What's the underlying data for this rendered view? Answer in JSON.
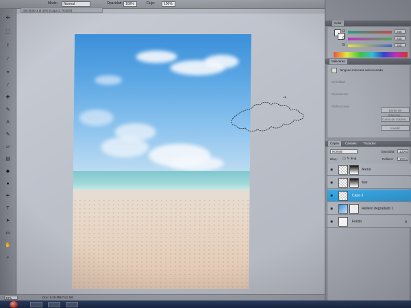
{
  "options_bar": {
    "mode_label": "Modo:",
    "mode_value": "Normal",
    "opacity_label": "Opacidad:",
    "opacity_value": "100%",
    "flow_label": "Flujo:",
    "flow_value": "100%"
  },
  "document_tab": {
    "title": "Sin título-1 al 33% (Capa 3, RGB/8)"
  },
  "tools": [
    "move",
    "marquee",
    "lasso",
    "magic-wand",
    "crop",
    "eyedropper",
    "healing",
    "brush",
    "stamp",
    "history",
    "eraser",
    "gradient",
    "blur",
    "dodge",
    "pen",
    "type",
    "path-select",
    "shape",
    "hand",
    "zoom"
  ],
  "color_panel": {
    "tab_label": "Color",
    "channels": [
      {
        "label": "R",
        "value": "255",
        "color": "#d9534f"
      },
      {
        "label": "G",
        "value": "255",
        "color": "#5cb85c"
      },
      {
        "label": "B",
        "value": "255",
        "color": "#4a6fd8"
      }
    ]
  },
  "masks_panel": {
    "tab_label": "Máscaras",
    "status": "Ninguna máscara seleccionada",
    "density_label": "Densidad:",
    "feather_label": "Desvanecer:",
    "refine_label": "Perfeccionar:",
    "buttons": [
      "Borde de máscara...",
      "Gama de colores...",
      "Invertir"
    ]
  },
  "layers_panel": {
    "tabs": [
      "Capas",
      "Canales",
      "Trazados"
    ],
    "blend_mode": "Normal",
    "opacity_label": "Opacidad:",
    "opacity_value": "100%",
    "lock_label": "Bloq.:",
    "fill_label": "Relleno:",
    "fill_value": "100%",
    "layers": [
      {
        "name": "Arena",
        "selected": false
      },
      {
        "name": "Mar",
        "selected": false
      },
      {
        "name": "Capa 3",
        "selected": true
      },
      {
        "name": "Relleno degradado 1",
        "selected": false
      },
      {
        "name": "Fondo",
        "selected": false
      }
    ]
  },
  "status_bar": {
    "zoom": "33%",
    "doc_info": "Doc: 6,29 MB/7,51 MB"
  },
  "colors": {
    "selected_layer": "#2d9bd8",
    "sky_top": "#3b8fd9",
    "sea": "#7fc7cd",
    "sand": "#e4cdb8"
  }
}
